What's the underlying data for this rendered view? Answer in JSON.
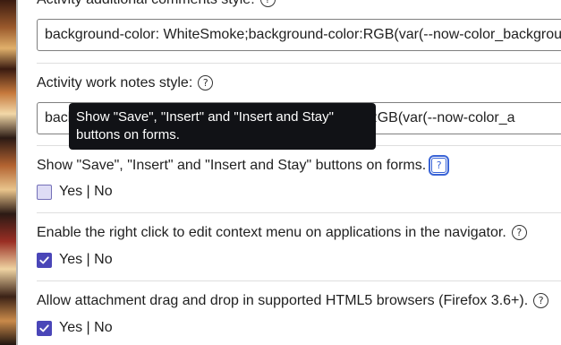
{
  "fields": {
    "additional_comments": {
      "label": "Activity additional comments style:",
      "value": "background-color: WhiteSmoke;background-color:RGB(var(--now-color_background"
    },
    "work_notes": {
      "label": "Activity work notes style:",
      "value": "background-color: WhiteSmoke;background-color: RGB(var(--now-color_a"
    },
    "show_save_buttons": {
      "label": "Show \"Save\", \"Insert\" and \"Insert and Stay\" buttons on forms.",
      "option_text": "Yes | No",
      "checked": false
    },
    "right_click_menu": {
      "label": "Enable the right click to edit context menu on applications in the navigator.",
      "option_text": "Yes | No",
      "checked": true
    },
    "attachment_drag_drop": {
      "label": "Allow attachment drag and drop in supported HTML5 browsers (Firefox 3.6+).",
      "option_text": "Yes | No",
      "checked": true
    }
  },
  "tooltip": {
    "line1": "Show \"Save\", \"Insert\" and \"Insert and Stay\"",
    "line2": "buttons on forms."
  },
  "icons": {
    "help": "question-circle-icon",
    "check": "checkmark-icon"
  },
  "colors": {
    "checkbox_checked": "#4a46b8",
    "checkbox_unchecked_fill": "#dedcf5",
    "tooltip_bg": "#111216",
    "focus_ring": "#3a64d6"
  }
}
